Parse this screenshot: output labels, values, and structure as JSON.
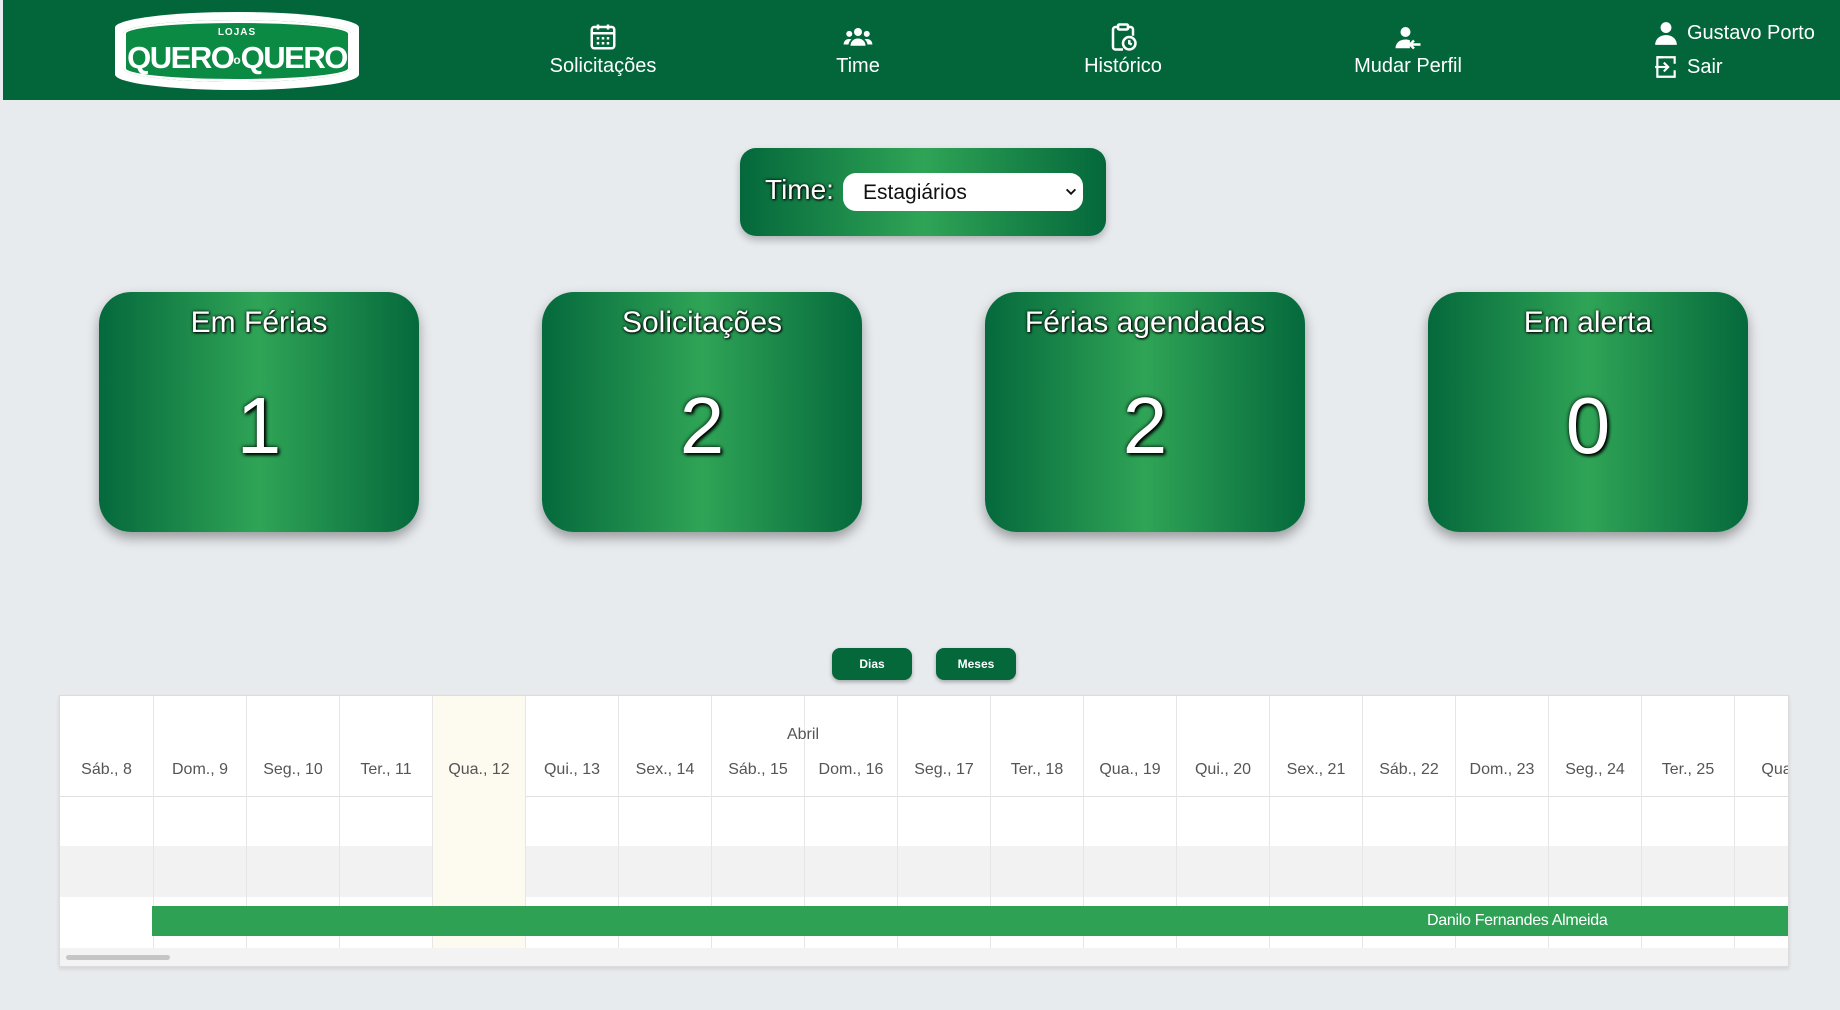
{
  "header": {
    "logo": {
      "small": "LOJAS",
      "left": "QUERO",
      "dot": "o",
      "right": "QUERO"
    },
    "nav": [
      {
        "label": "Solicitações",
        "icon": "calendar-icon"
      },
      {
        "label": "Time",
        "icon": "users-icon"
      },
      {
        "label": "Histórico",
        "icon": "clipboard-clock-icon"
      },
      {
        "label": "Mudar Perfil",
        "icon": "user-switch-icon"
      }
    ],
    "user": {
      "name": "Gustavo Porto",
      "logout": "Sair"
    }
  },
  "team": {
    "label": "Time:",
    "selected": "Estagiários"
  },
  "cards": [
    {
      "title": "Em Férias",
      "value": "1"
    },
    {
      "title": "Solicitações",
      "value": "2"
    },
    {
      "title": "Férias agendadas",
      "value": "2"
    },
    {
      "title": "Em alerta",
      "value": "0"
    }
  ],
  "view_buttons": {
    "days": "Dias",
    "months": "Meses"
  },
  "timeline": {
    "month": "Abril",
    "days": [
      "Sáb., 8",
      "Dom., 9",
      "Seg., 10",
      "Ter., 11",
      "Qua., 12",
      "Qui., 13",
      "Sex., 14",
      "Sáb., 15",
      "Dom., 16",
      "Seg., 17",
      "Ter., 18",
      "Qua., 19",
      "Qui., 20",
      "Sex., 21",
      "Sáb., 22",
      "Dom., 23",
      "Seg., 24",
      "Ter., 25",
      "Qua.,"
    ],
    "event": "Danilo Fernandes Almeida"
  },
  "colors": {
    "primary": "#03663a",
    "accent": "#2fa456",
    "bar": "#2fa155",
    "background": "#e8ebee"
  }
}
